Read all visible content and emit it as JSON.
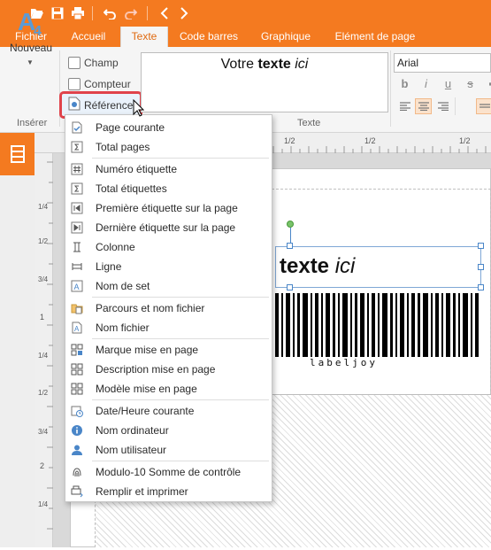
{
  "toolbar": {
    "icons": [
      "open-folder-icon",
      "save-icon",
      "print-icon",
      "undo-icon",
      "redo-icon",
      "back-icon",
      "forward-icon"
    ]
  },
  "tabs": [
    {
      "label": "Fichier"
    },
    {
      "label": "Accueil"
    },
    {
      "label": "Texte",
      "active": true
    },
    {
      "label": "Code barres"
    },
    {
      "label": "Graphique"
    },
    {
      "label": "Elément de page"
    }
  ],
  "ribbon": {
    "nouveau_label": "Nouveau",
    "inserer_label": "Insérer",
    "champ_label": "Champ",
    "compteur_label": "Compteur",
    "reference_label": "Référence",
    "texte_group_label": "Texte",
    "text_preview": {
      "plain": "Votre ",
      "bold": "texte",
      "italic": "ici"
    },
    "font_name": "Arial",
    "format_buttons": [
      "b",
      "i",
      "u",
      "s"
    ]
  },
  "canvas": {
    "ruler_top": [
      "1/2",
      "1/2",
      "1/2"
    ],
    "ruler_left": [
      "1/4",
      "1/2",
      "3/4",
      "1",
      "1/4",
      "1/2",
      "3/4",
      "2",
      "1/4"
    ],
    "text_object": {
      "bold": "texte",
      "italic": "ici"
    },
    "barcode_text": "labeljoy"
  },
  "menu": {
    "items": [
      {
        "label": "Page courante",
        "icon": "page-check-icon"
      },
      {
        "label": "Total pages",
        "icon": "sigma-icon"
      },
      {
        "label": "Numéro étiquette",
        "icon": "hash-icon"
      },
      {
        "label": "Total étiquettes",
        "icon": "sigma-icon"
      },
      {
        "label": "Première étiquette sur la page",
        "icon": "first-label-icon"
      },
      {
        "label": "Dernière étiquette sur la page",
        "icon": "last-label-icon"
      },
      {
        "label": "Colonne",
        "icon": "column-icon"
      },
      {
        "label": "Ligne",
        "icon": "row-icon"
      },
      {
        "label": "Nom de set",
        "icon": "set-name-icon"
      },
      {
        "label": "Parcours et nom fichier",
        "icon": "folder-file-icon"
      },
      {
        "label": "Nom fichier",
        "icon": "file-icon"
      },
      {
        "label": "Marque mise en page",
        "icon": "layout-brand-icon"
      },
      {
        "label": "Description mise en page",
        "icon": "layout-description-icon"
      },
      {
        "label": "Modèle mise en page",
        "icon": "layout-model-icon"
      },
      {
        "label": "Date/Heure courante",
        "icon": "calendar-clock-icon"
      },
      {
        "label": "Nom ordinateur",
        "icon": "computer-info-icon"
      },
      {
        "label": "Nom utilisateur",
        "icon": "user-icon"
      },
      {
        "label": "Modulo-10 Somme de contrôle",
        "icon": "fingerprint-icon"
      },
      {
        "label": "Remplir et imprimer",
        "icon": "fill-print-icon"
      }
    ]
  },
  "colors": {
    "accent": "#f47a20",
    "highlight_border": "#e0434b",
    "active_tab_text": "#e06a10"
  }
}
